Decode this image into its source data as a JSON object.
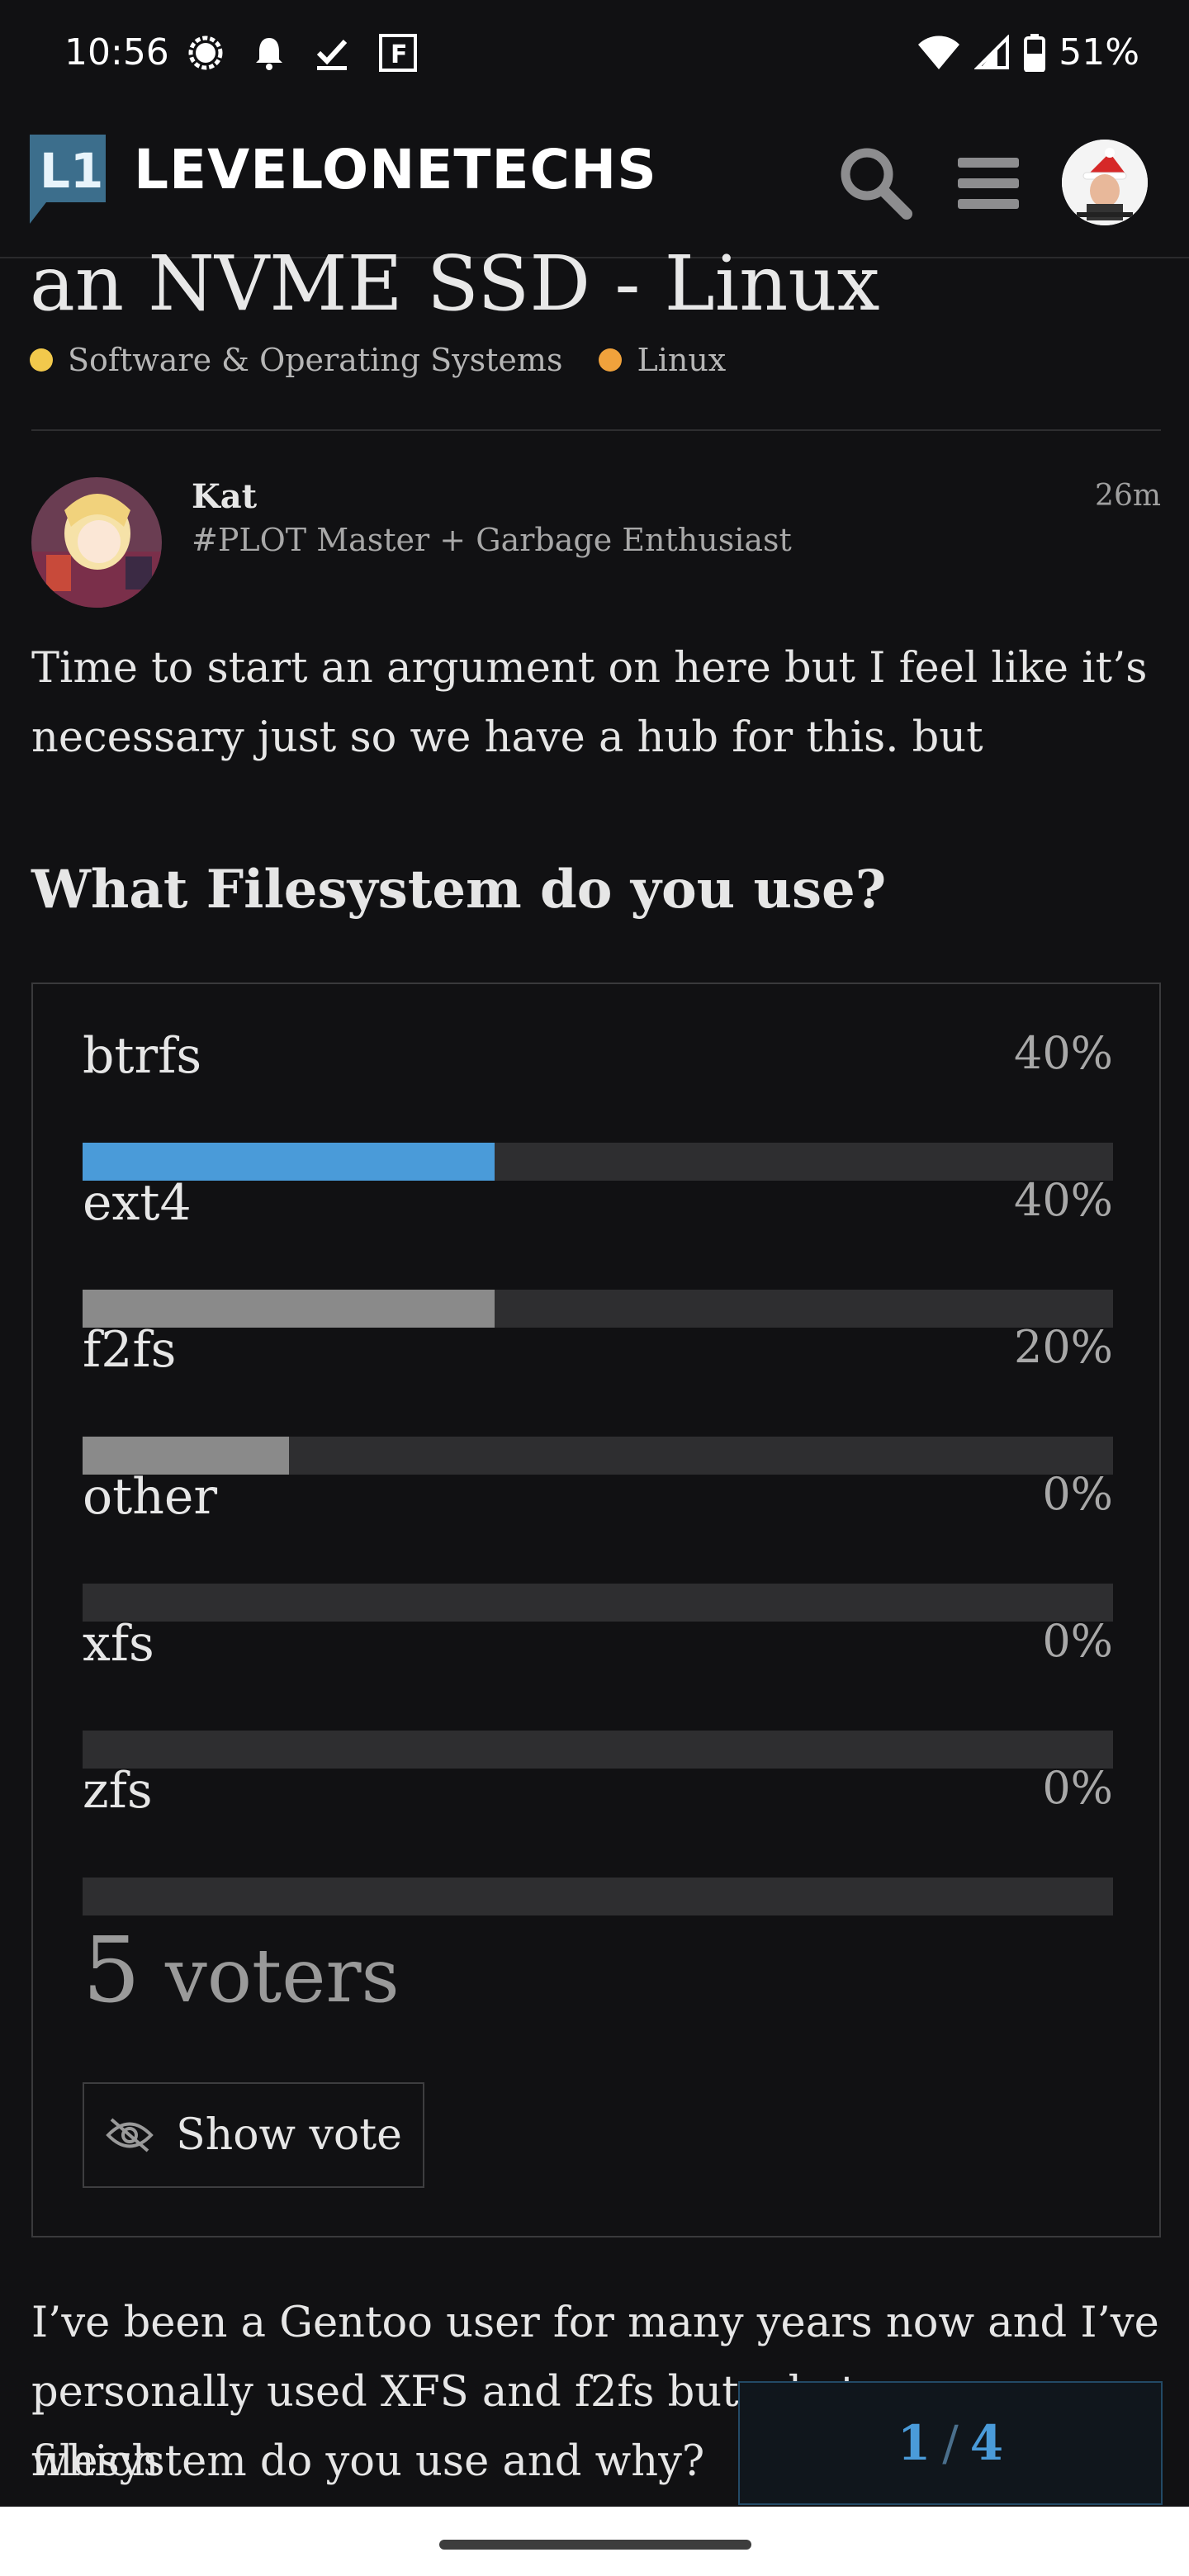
{
  "status_bar": {
    "time": "10:56",
    "battery": "51%"
  },
  "header": {
    "brand": "LEVELONETECHS",
    "logo_text": "L1"
  },
  "topic": {
    "title_visible": "an NVME SSD - Linux",
    "categories": [
      {
        "name": "Software & Operating Systems",
        "color": "#f2c94c"
      },
      {
        "name": "Linux",
        "color": "#f0a23c"
      }
    ]
  },
  "post": {
    "username": "Kat",
    "user_title": "#PLOT Master + Garbage Enthusiast",
    "time": "26m",
    "intro": "Time to start an argument on here but I feel like it’s necessary just so we have a hub for this. but",
    "poll": {
      "question": "What Filesystem do you use?",
      "options": [
        {
          "label": "btrfs",
          "percent": "40%",
          "value": 40,
          "winner": true
        },
        {
          "label": "ext4",
          "percent": "40%",
          "value": 40,
          "winner": false
        },
        {
          "label": "f2fs",
          "percent": "20%",
          "value": 20,
          "winner": false
        },
        {
          "label": "other",
          "percent": "0%",
          "value": 0,
          "winner": false
        },
        {
          "label": "xfs",
          "percent": "0%",
          "value": 0,
          "winner": false
        },
        {
          "label": "zfs",
          "percent": "0%",
          "value": 0,
          "winner": false
        }
      ],
      "voters_count": "5",
      "voters_label": "voters",
      "show_vote_label": "Show vote"
    },
    "body_line1": "I’ve been a Gentoo user for many years now and I’ve",
    "body_line2": "personally used XFS and f2fs but what are your which",
    "body_line3": "filesystem do you use and why?"
  },
  "progress": {
    "current": "1",
    "total": "4"
  },
  "colors": {
    "accent": "#4a9bd9",
    "background": "#111113",
    "bar_track": "#2e2e30",
    "bar_fill": "#8a8a8a"
  }
}
